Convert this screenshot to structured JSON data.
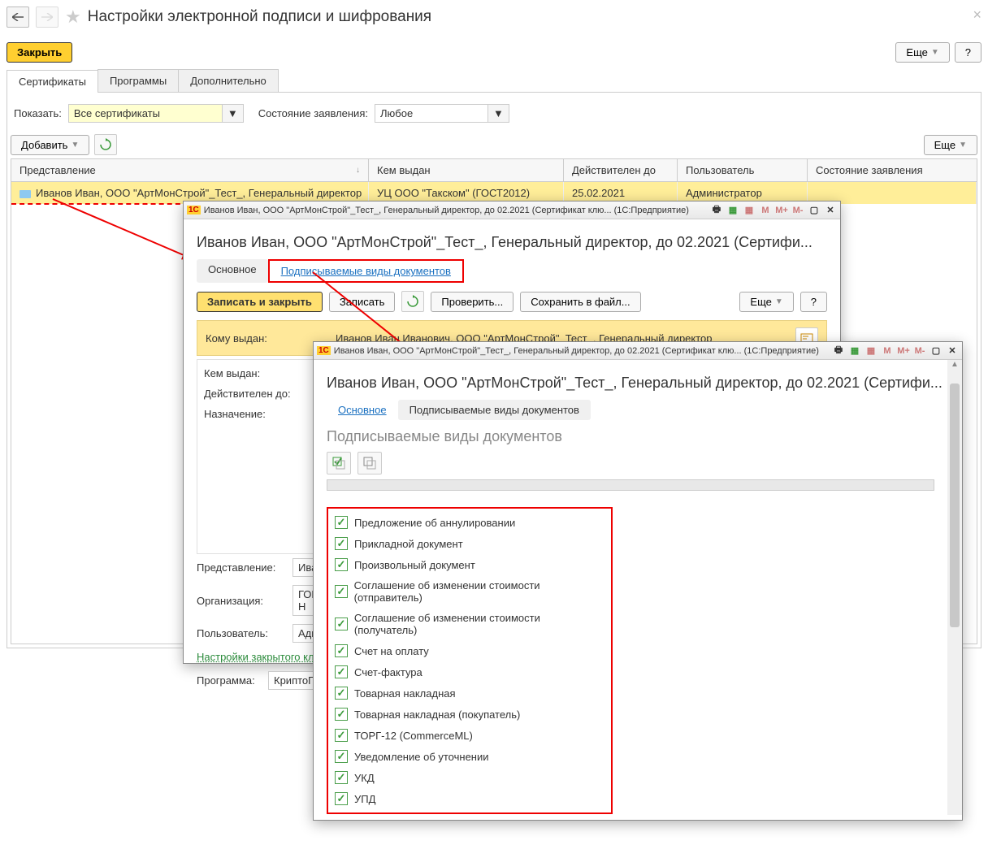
{
  "main": {
    "title": "Настройки электронной подписи и шифрования",
    "close_btn": "Закрыть",
    "more_btn": "Еще",
    "help_btn": "?",
    "tabs": [
      "Сертификаты",
      "Программы",
      "Дополнительно"
    ],
    "filters": {
      "show_label": "Показать:",
      "show_value": "Все сертификаты",
      "state_label": "Состояние заявления:",
      "state_value": "Любое"
    },
    "add_btn": "Добавить",
    "columns": {
      "repr": "Представление",
      "issuer": "Кем выдан",
      "valid": "Действителен до",
      "user": "Пользователь",
      "state": "Состояние заявления"
    },
    "row": {
      "repr": "Иванов Иван, ООО \"АртМонСтрой\"_Тест_, Генеральный директор",
      "issuer": "УЦ ООО \"Такском\" (ГОСТ2012)",
      "valid": "25.02.2021",
      "user": "Администратор"
    }
  },
  "dialog1": {
    "winbar": "Иванов Иван, ООО \"АртМонСтрой\"_Тест_, Генеральный директор, до 02.2021 (Сертификат клю...  (1С:Предприятие)",
    "title": "Иванов Иван, ООО \"АртМонСтрой\"_Тест_, Генеральный директор, до 02.2021 (Сертифи...",
    "tab_main": "Основное",
    "tab_docs": "Подписываемые виды документов",
    "btn_save_close": "Записать и закрыть",
    "btn_save": "Записать",
    "btn_check": "Проверить...",
    "btn_export": "Сохранить в файл...",
    "more_btn": "Еще",
    "help_btn": "?",
    "issued_to_label": "Кому выдан:",
    "issued_to": "Иванов Иван Иванович, ООО \"АртМонСтрой\"_Тест_, Генеральный директор",
    "issued_by_label": "Кем выдан:",
    "valid_label": "Действителен до:",
    "purpose_label": "Назначение:",
    "repr_label": "Представление:",
    "repr_value": "Иванов",
    "org_label": "Организация:",
    "org_value": "ГОБУ Н",
    "user_label": "Пользователь:",
    "user_value": "Админ",
    "secret_key_link": "Настройки закрытого кл",
    "program_label": "Программа:",
    "program_value": "КриптоПро"
  },
  "dialog2": {
    "winbar": "Иванов Иван, ООО \"АртМонСтрой\"_Тест_, Генеральный директор, до 02.2021 (Сертификат клю...  (1С:Предприятие)",
    "title": "Иванов Иван, ООО \"АртМонСтрой\"_Тест_, Генеральный директор, до 02.2021 (Сертифи...",
    "tab_main": "Основное",
    "tab_docs": "Подписываемые виды документов",
    "section": "Подписываемые виды документов",
    "items": [
      "Предложение об аннулировании",
      "Прикладной документ",
      "Произвольный документ",
      "Соглашение об изменении стоимости (отправитель)",
      "Соглашение об изменении стоимости (получатель)",
      "Счет на оплату",
      "Счет-фактура",
      "Товарная накладная",
      "Товарная накладная (покупатель)",
      "ТОРГ-12 (CommerceML)",
      "Уведомление об уточнении",
      "УКД",
      "УПД"
    ]
  }
}
